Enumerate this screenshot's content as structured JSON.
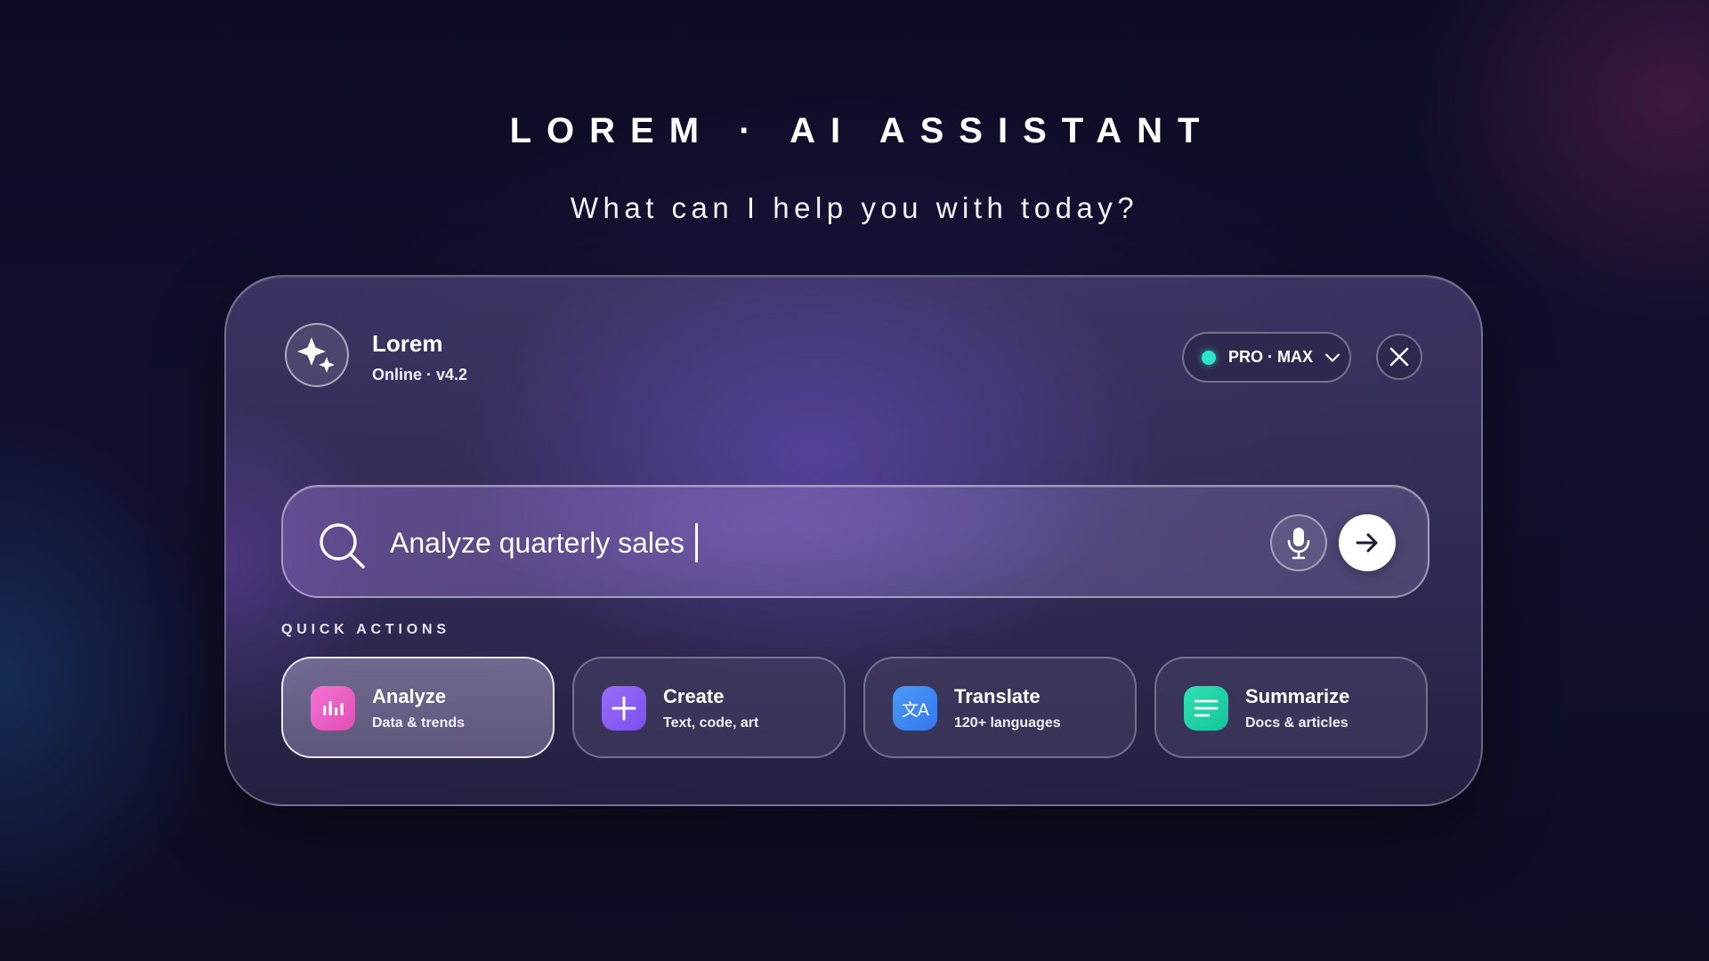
{
  "header": {
    "title": "LOREM · AI ASSISTANT",
    "subtitle": "What can I help you with today?"
  },
  "assistant": {
    "name": "Lorem",
    "status": "Online · v4.2",
    "avatar_icon": "sparkle-icon"
  },
  "plan": {
    "label": "PRO · MAX",
    "status_color": "#2ee6c8",
    "icon": "chevron-down-icon"
  },
  "close": {
    "icon": "close-icon"
  },
  "search": {
    "value": "Analyze quarterly sales",
    "icon": "search-icon",
    "mic_icon": "microphone-icon",
    "send_icon": "arrow-right-icon"
  },
  "quick_actions": {
    "label": "QUICK ACTIONS",
    "items": [
      {
        "title": "Analyze",
        "description": "Data & trends",
        "icon": "bar-chart-icon",
        "color": "#f062c8",
        "active": true
      },
      {
        "title": "Create",
        "description": "Text, code, art",
        "icon": "plus-icon",
        "color": "#8b5cf6",
        "active": false
      },
      {
        "title": "Translate",
        "description": "120+ languages",
        "icon": "translate-icon",
        "glyph": "文A",
        "color": "#3b82f6",
        "active": false
      },
      {
        "title": "Summarize",
        "description": "Docs & articles",
        "icon": "lines-icon",
        "color": "#22d3a6",
        "active": false
      }
    ]
  }
}
